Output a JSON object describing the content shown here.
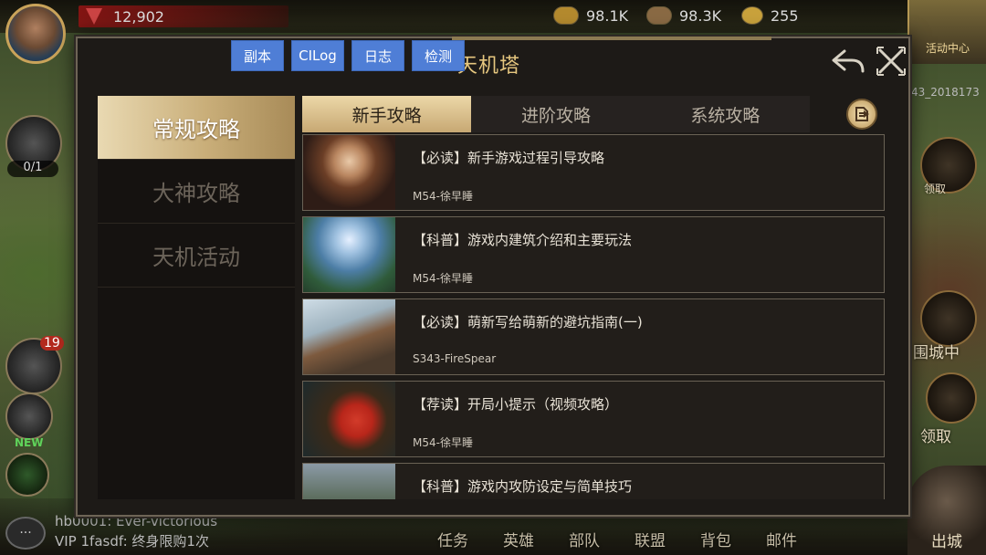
{
  "hud": {
    "power": "12,902",
    "resources": [
      {
        "icon": "food-icon",
        "value": "98.1K"
      },
      {
        "icon": "wood-icon",
        "value": "98.3K"
      },
      {
        "icon": "gold-icon",
        "value": "255"
      }
    ],
    "activity_center": "活动中心",
    "server_id_fragment": "43_2018173",
    "hammer_counter": "0/1",
    "settings_badge": "19",
    "new_label": "NEW",
    "claim_label_1": "领取",
    "siege_label": "围城中",
    "claim_label_2": "领取",
    "chat_line_1": "hb0001: Ever-victorious",
    "chat_line_2": "VIP 1fasdf: 终身限购1次",
    "nav": [
      "任务",
      "英雄",
      "部队",
      "联盟",
      "背包",
      "邮件"
    ],
    "exit_city": "出城"
  },
  "panel": {
    "title": "天机塔",
    "debug_buttons": [
      "副本",
      "CILog",
      "日志",
      "检测"
    ],
    "sidebar": [
      "常规攻略",
      "大神攻略",
      "天机活动"
    ],
    "tabs": [
      "新手攻略",
      "进阶攻略",
      "系统攻略"
    ],
    "items": [
      {
        "title": "【必读】新手游戏过程引导攻略",
        "author": "M54-徐早睡"
      },
      {
        "title": "【科普】游戏内建筑介绍和主要玩法",
        "author": "M54-徐早睡"
      },
      {
        "title": "【必读】萌新写给萌新的避坑指南(一)",
        "author": "S343-FireSpear"
      },
      {
        "title": "【荐读】开局小提示（视频攻略）",
        "author": "M54-徐早睡"
      },
      {
        "title": "【科普】游戏内攻防设定与简单技巧",
        "author": ""
      }
    ]
  },
  "colors": {
    "accent_gold": "#e6c77f",
    "debug_blue": "#4f7ed6",
    "panel_bg": "#1d1a17"
  }
}
